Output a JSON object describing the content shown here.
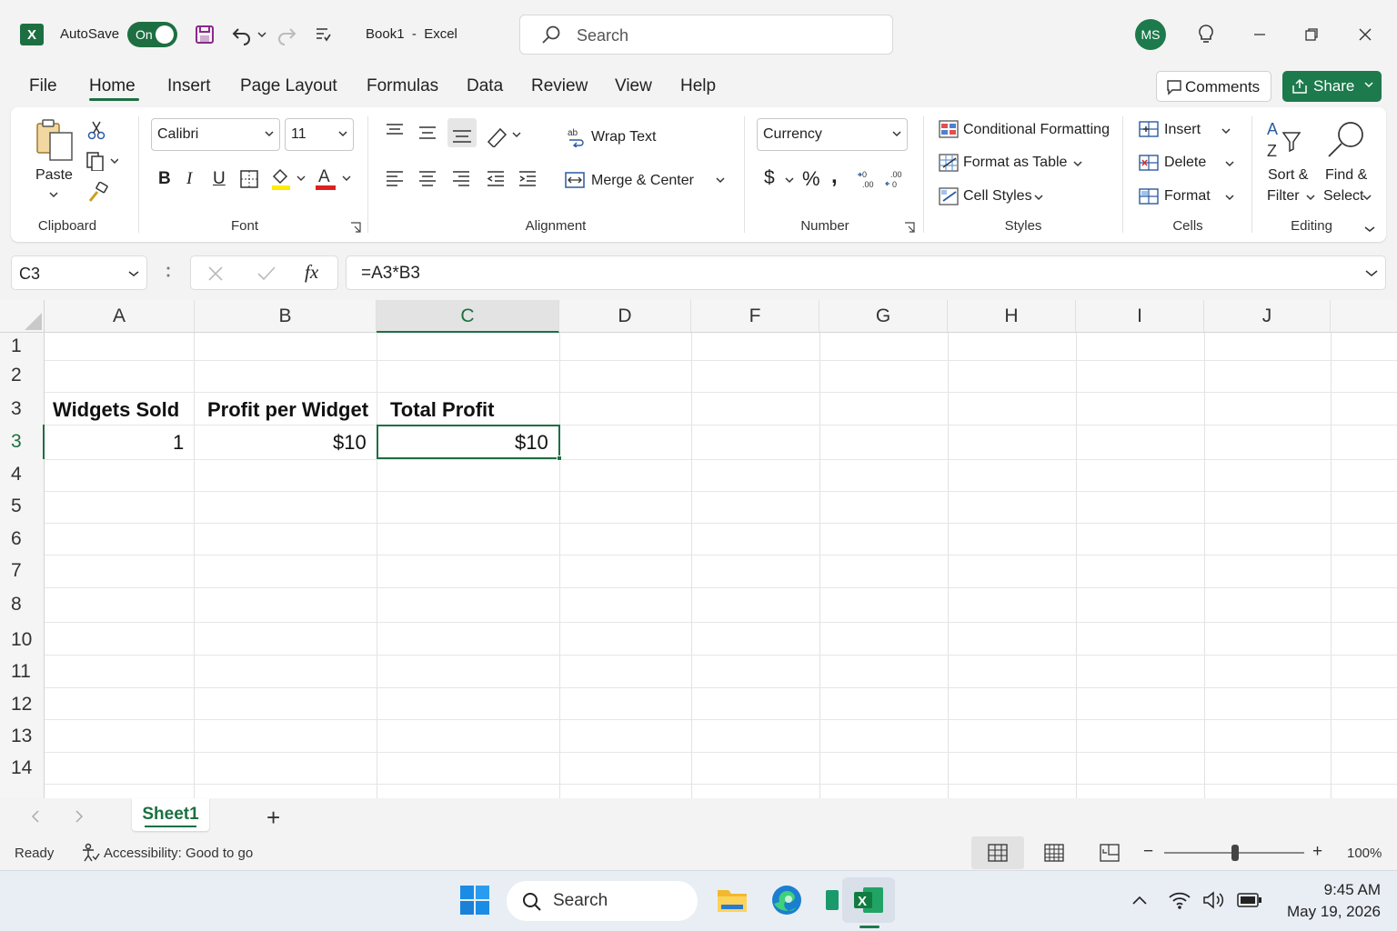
{
  "title_bar": {
    "autosave_label": "AutoSave",
    "autosave_state": "On",
    "document_title": "Book1  -  Excel",
    "search_placeholder": "Search",
    "user_initials": "MS"
  },
  "menu": {
    "tabs": [
      "File",
      "Home",
      "Insert",
      "Page Layout",
      "Formulas",
      "Data",
      "Review",
      "View",
      "Help"
    ],
    "active_tab": "Home",
    "comments_label": "Comments",
    "share_label": "Share"
  },
  "ribbon": {
    "clipboard": {
      "paste_label": "Paste",
      "group_label": "Clipboard"
    },
    "font": {
      "font_name": "Calibri",
      "font_size": "11",
      "group_label": "Font",
      "bold": "B",
      "italic": "I",
      "underline": "U"
    },
    "alignment": {
      "wrap_text": "Wrap Text",
      "merge_center": "Merge & Center",
      "group_label": "Alignment"
    },
    "number": {
      "format": "Currency",
      "currency_symbol": "$",
      "percent": "%",
      "comma": ",",
      "group_label": "Number"
    },
    "styles": {
      "conditional_formatting": "Conditional Formatting",
      "format_as_table": "Format as Table",
      "cell_styles": "Cell Styles",
      "group_label": "Styles"
    },
    "cells": {
      "insert": "Insert",
      "delete": "Delete",
      "format": "Format",
      "group_label": "Cells"
    },
    "editing": {
      "sort_filter_line1": "Sort &",
      "sort_filter_line2": "Filter",
      "find_select_line1": "Find &",
      "find_select_line2": "Select",
      "group_label": "Editing"
    }
  },
  "formula_bar": {
    "name_box": "C3",
    "fx_label": "fx",
    "formula": "=A3*B3"
  },
  "grid": {
    "columns": [
      "A",
      "B",
      "C",
      "D",
      "F",
      "G",
      "H",
      "I",
      "J"
    ],
    "selected_column": "C",
    "rows": [
      "1",
      "2",
      "3",
      "3",
      "4",
      "5",
      "6",
      "7",
      "8",
      "10",
      "11",
      "12",
      "13",
      "14"
    ],
    "cells": {
      "a_header": "Widgets Sold",
      "b_header": "Profit per Widget",
      "c_header": "Total Profit",
      "a_value": "1",
      "b_value": "$10",
      "c_value": "$10"
    }
  },
  "sheets": {
    "active": "Sheet1",
    "add_label": "+"
  },
  "status_bar": {
    "ready": "Ready",
    "accessibility": "Accessibility: Good to go",
    "zoom_minus": "−",
    "zoom_plus": "+",
    "zoom": "100%"
  },
  "taskbar": {
    "search_label": "Search",
    "time": "9:45 AM",
    "date": "May 19, 2026"
  }
}
